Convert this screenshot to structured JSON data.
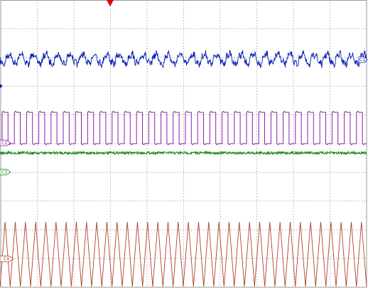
{
  "scope": {
    "background": "#ffffff",
    "grid_color": "#9a9a9a",
    "grid": {
      "h_divisions": 10,
      "v_divisions": 10,
      "line_style": "dotted",
      "border": "solid"
    },
    "trigger_marker": {
      "icon": "down-triangle-icon",
      "color": "#e00000"
    },
    "channels": [
      {
        "id": "C1",
        "label": "C1",
        "color": "#0b22b0",
        "trace_type": "noisy-ripple",
        "cycles": 30
      },
      {
        "id": "C2",
        "label": "C2",
        "color": "#8a1fa8",
        "trace_type": "square-wave",
        "cycles": 30
      },
      {
        "id": "C3",
        "label": "C3",
        "color": "#138a12",
        "trace_type": "flat-noise",
        "cycles": 0
      },
      {
        "id": "C4",
        "label": "C4",
        "color": "#b2402e",
        "trace_type": "triangle-wave",
        "cycles": 36
      }
    ]
  }
}
